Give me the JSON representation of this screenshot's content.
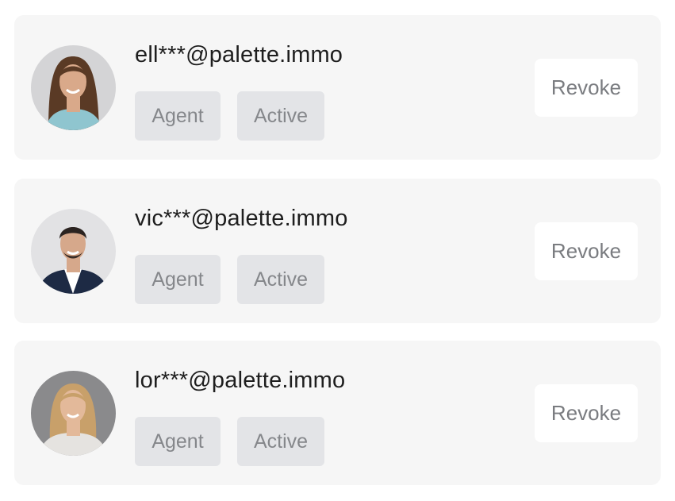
{
  "members": [
    {
      "email": "ell***@palette.immo",
      "role": "Agent",
      "status": "Active",
      "action_label": "Revoke",
      "avatar": {
        "hair": "#5a3a25",
        "skin": "#d9a98a",
        "shirt": "#8fc5cf",
        "bg": "#d4d4d6"
      }
    },
    {
      "email": "vic***@palette.immo",
      "role": "Agent",
      "status": "Active",
      "action_label": "Revoke",
      "avatar": {
        "hair": "#2b2320",
        "skin": "#d6a88b",
        "shirt": "#1d2a44",
        "bg": "#e2e2e4"
      }
    },
    {
      "email": "lor***@palette.immo",
      "role": "Agent",
      "status": "Active",
      "action_label": "Revoke",
      "avatar": {
        "hair": "#c8a06a",
        "skin": "#e3b99a",
        "shirt": "#e5e3e0",
        "bg": "#8a8a8c"
      }
    }
  ]
}
